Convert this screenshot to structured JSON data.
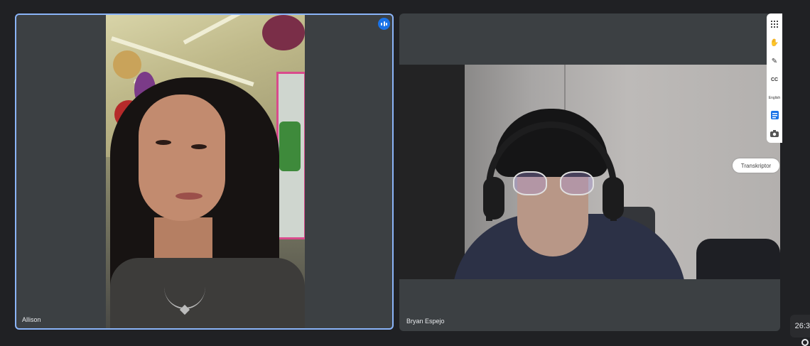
{
  "participants": [
    {
      "name": "Allison",
      "speaking": true
    },
    {
      "name": "Bryan Espejo",
      "speaking": false
    }
  ],
  "overlay": {
    "transkriptor_alt": "Transkriptor"
  },
  "rail": {
    "captions_label": "CC",
    "language_label": "English"
  },
  "clock": {
    "time": "26:3"
  },
  "colors": {
    "background": "#202124",
    "tile": "#3c4043",
    "active_border": "#8ab4f8",
    "speaking_badge": "#1a73e8"
  },
  "icons": [
    "speaking-indicator-icon",
    "apps-grid-icon",
    "hand-icon",
    "pen-icon",
    "captions-icon",
    "language-icon",
    "notes-icon",
    "camera-icon",
    "transkriptor-icon",
    "clock-icon"
  ]
}
